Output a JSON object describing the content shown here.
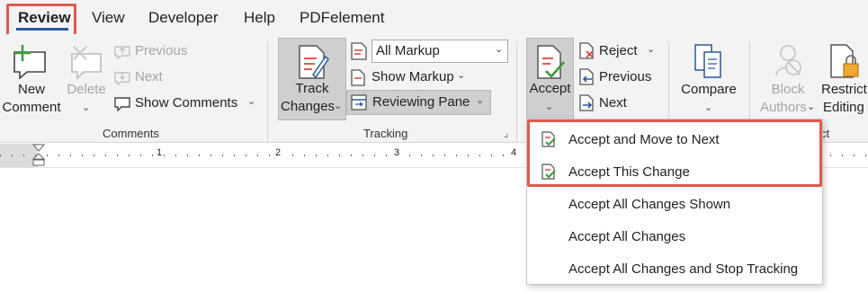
{
  "tabs": [
    {
      "label": "Review",
      "active": true
    },
    {
      "label": "View"
    },
    {
      "label": "Developer"
    },
    {
      "label": "Help"
    },
    {
      "label": "PDFelement"
    }
  ],
  "comments": {
    "new_comment": [
      "New",
      "Comment"
    ],
    "delete": "Delete",
    "previous": "Previous",
    "next": "Next",
    "show_comments": "Show Comments",
    "group_label": "Comments"
  },
  "tracking": {
    "track_changes": [
      "Track",
      "Changes"
    ],
    "markup_select": "All Markup",
    "show_markup": "Show Markup",
    "reviewing_pane": "Reviewing Pane",
    "group_label": "Tracking"
  },
  "changes": {
    "accept": "Accept",
    "reject": "Reject",
    "previous": "Previous",
    "next": "Next"
  },
  "compare": {
    "label": "Compare"
  },
  "protect": {
    "block_authors": [
      "Block",
      "Authors"
    ],
    "restrict_editing": [
      "Restrict",
      "Editing"
    ],
    "group_label_partial": "ct"
  },
  "ruler": {
    "numbers": [
      "1",
      "2",
      "3",
      "4"
    ]
  },
  "accept_menu": {
    "items": [
      {
        "label": "Accept and Move to Next",
        "enabled": true,
        "highlighted": true
      },
      {
        "label": "Accept This Change",
        "enabled": true,
        "highlighted": true
      },
      {
        "label": "Accept All Changes Shown",
        "enabled": false
      },
      {
        "label": "Accept All Changes",
        "enabled": true
      },
      {
        "label": "Accept All Changes and Stop Tracking",
        "enabled": true
      }
    ]
  },
  "colors": {
    "accent": "#2b579a",
    "highlight": "#e05a4f",
    "green": "#3a9b3a",
    "icon_red": "#d9433b"
  }
}
